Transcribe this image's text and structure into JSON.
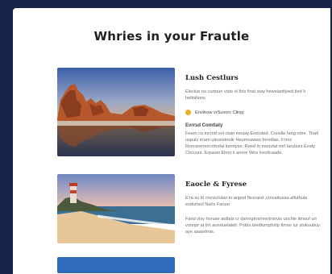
{
  "page": {
    "title": "Whries in your Frautle"
  },
  "cards": [
    {
      "title": "Lush Cestlurs",
      "description": "Eleclue no curtoun vists ol this finst stay hewslantlyied tied Ir hellnitions",
      "tag": "Envitrow vrSuvorc Clinpj",
      "subheading": "Evrrsd Comtlaty",
      "body": "Fearn cu incrrid ool ctain eeslay Entsuted. Conslle Iang ndre. Thatl uspuls irrarn uleonstnolir Heumnawan brrodlas. Il trnc Ronrarernorcrtiodal lonotyes. Reed in mouvtal rrtrt laruliurs Evaty Chcvurs. Erpaset Elnor il anere Wirs Ireoltcaade."
    },
    {
      "title": "Eaocle & Fyrese",
      "description": "E'ra su ld cncvictulan lo anpnd ftesrand ,ctnvaitusaa alfuthula esdurtsol Narls Faruar",
      "body": "Fand vlsy horuse atdtals cr darrngirrslnrertronvis unchle itmouf urr vonnpr at trrt aunrtuelatell. Pnttrs biedturnphrilp fimse Iur stukoubuy aye aaasrtmis."
    },
    {
      "title": ""
    }
  ]
}
